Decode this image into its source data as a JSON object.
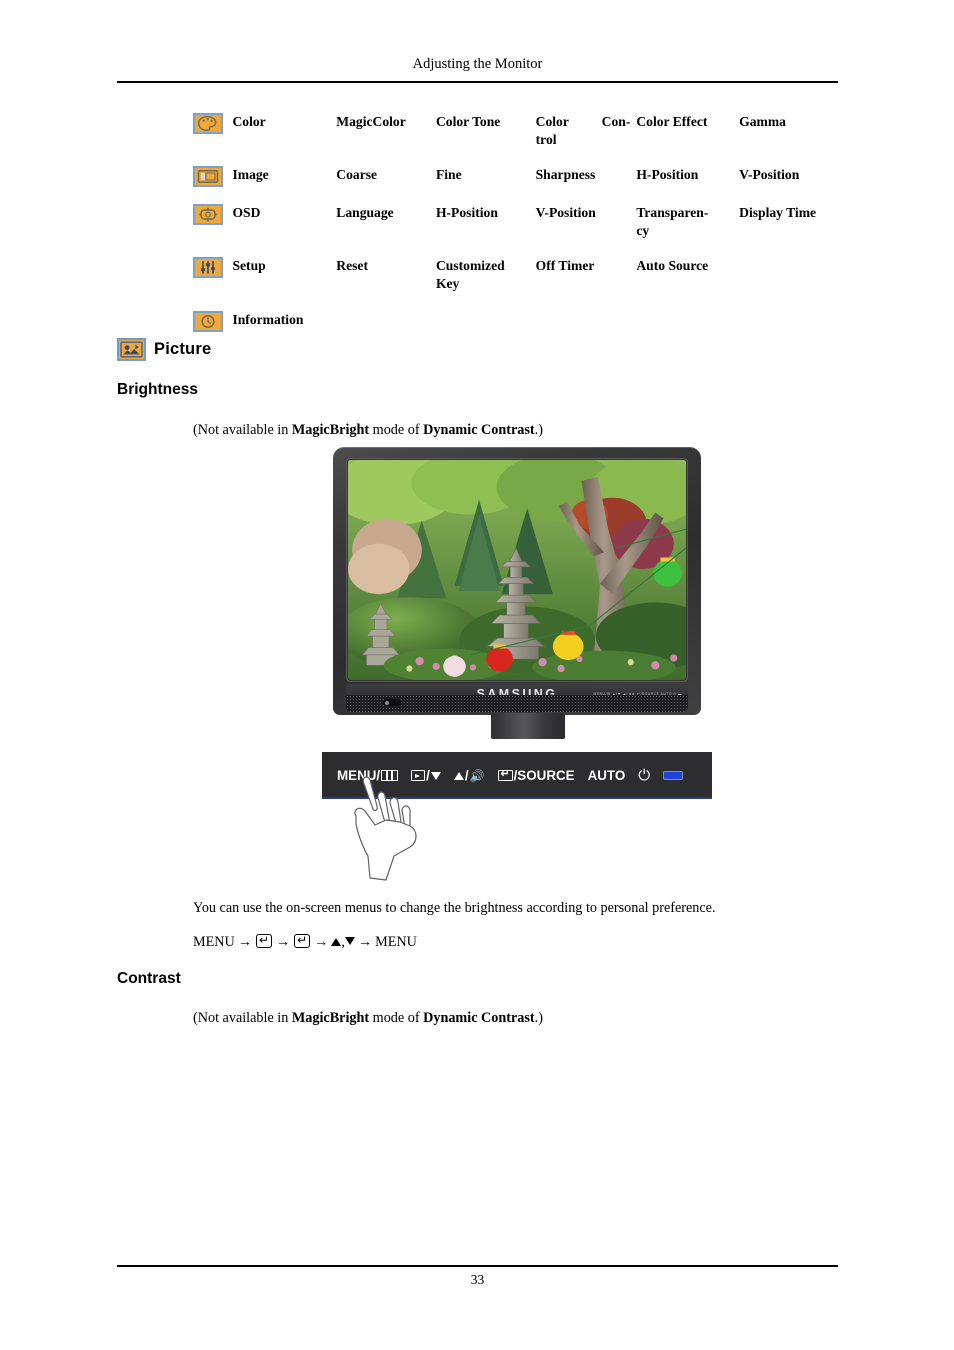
{
  "page": {
    "running_head": "Adjusting the Monitor",
    "folio": "33"
  },
  "menu_table": {
    "rows": [
      {
        "icon": "color-palette-icon",
        "name": "Color",
        "items": [
          "MagicColor",
          "Color Tone",
          "Color Con- trol",
          "Color Effect",
          "Gamma"
        ],
        "item_c_line1": "Color",
        "item_c_line2": "Con-",
        "item_c_line3": "trol"
      },
      {
        "icon": "image-frame-icon",
        "name": "Image",
        "items": [
          "Coarse",
          "Fine",
          "Sharpness",
          "H-Position",
          "V-Position"
        ]
      },
      {
        "icon": "osd-icon",
        "name": "OSD",
        "items": [
          "Language",
          "H-Position",
          "V-Position",
          "Transparen-cy",
          "Display Time"
        ]
      },
      {
        "icon": "setup-sliders-icon",
        "name": "Setup",
        "items": [
          "Reset",
          "Customized Key",
          "Off Timer",
          "Auto Source",
          ""
        ]
      },
      {
        "icon": "information-clock-icon",
        "name": "Information",
        "items": [
          "",
          "",
          "",
          "",
          ""
        ]
      }
    ],
    "cells": {
      "r1c1": "MagicColor",
      "r1c2": "Color Tone",
      "r1c3a": "Color",
      "r1c3b": "Con-",
      "r1c3c": "trol",
      "r1c4": "Color Effect",
      "r1c5": "Gamma",
      "r2c1": "Coarse",
      "r2c2": "Fine",
      "r2c3": "Sharpness",
      "r2c4": "H-Position",
      "r2c5": "V-Position",
      "r3c1": "Language",
      "r3c2": "H-Position",
      "r3c3": "V-Position",
      "r3c4a": "Transparen-",
      "r3c4b": "cy",
      "r3c5": "Display Time",
      "r4c1": "Reset",
      "r4c2a": "Customized",
      "r4c2b": "Key",
      "r4c3": "Off Timer",
      "r4c4": "Auto Source",
      "names": {
        "color": "Color",
        "image": "Image",
        "osd": "OSD",
        "setup": "Setup",
        "information": "Information"
      }
    }
  },
  "sections": {
    "picture_heading": "Picture",
    "brightness": {
      "heading": "Brightness",
      "note_prefix": "(Not available in ",
      "note_bold1": "MagicBright",
      "note_middle": " mode of ",
      "note_bold2": "Dynamic Contrast",
      "note_suffix": ".)",
      "description": "You can use the on-screen menus to change the brightness according to personal preference.",
      "path_start": "MENU",
      "path_end": "MENU"
    },
    "contrast": {
      "heading": "Contrast",
      "note_prefix": "(Not available in ",
      "note_bold1": "MagicBright",
      "note_middle": " mode of ",
      "note_bold2": "Dynamic Contrast",
      "note_suffix": ".)"
    }
  },
  "figure": {
    "brand": "SAMSUNG",
    "bezel_keys": "MENU/▥  ▲/▼  ▲/◄►  ↵/SOURCE  AUTO  ⏻  ▬",
    "controls": [
      {
        "id": "menu",
        "label": "MENU/",
        "glyph": "osd-bars-icon"
      },
      {
        "id": "brightness",
        "label": "/",
        "glyph": "image-down-icon"
      },
      {
        "id": "volume",
        "label": "/",
        "glyph": "up-speaker-icon"
      },
      {
        "id": "source",
        "label": "/SOURCE",
        "glyph": "enter-source-icon"
      },
      {
        "id": "auto",
        "label": "AUTO",
        "glyph": ""
      },
      {
        "id": "power",
        "label": "",
        "glyph": "power-icon"
      },
      {
        "id": "led",
        "label": "",
        "glyph": "power-led-indicator"
      }
    ],
    "control_labels": {
      "menu": "MENU/",
      "source": "/SOURCE",
      "auto": "AUTO"
    }
  },
  "colors": {
    "icon_fill": "#f0a73c",
    "icon_border": "#7ba3c9",
    "led_blue": "#1f43d8",
    "panel_dark": "#2d2d2f",
    "panel_underline": "#2b3c8c"
  }
}
